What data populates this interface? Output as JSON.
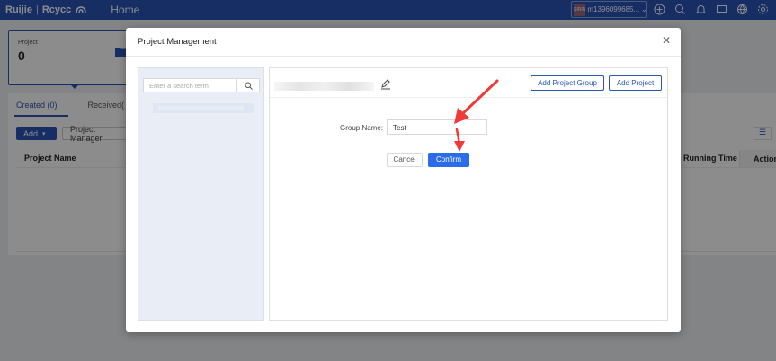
{
  "topbar": {
    "brand": "Ruijie",
    "brand_product": "Rcycc",
    "home_tab": "Home",
    "user_avatar_text": "SIRIN",
    "user_account": "m1396099685..."
  },
  "background": {
    "project_card_label": "Project",
    "project_card_count": "0",
    "tab_created": "Created (0)",
    "tab_received": "Received(",
    "add_button": "Add",
    "add_caret": "▾",
    "project_manager_button": "Project Manager",
    "col_project_name": "Project Name",
    "col_running_time": "Running Time",
    "col_action": "Action"
  },
  "modal": {
    "title": "Project Management",
    "close": "✕",
    "search_placeholder": "Enter a search term",
    "add_project_group": "Add Project Group",
    "add_project": "Add Project",
    "group_name_label": "Group Name:",
    "group_name_value": "Test",
    "cancel": "Cancel",
    "confirm": "Confirm"
  },
  "colors": {
    "accent": "#2b55b8",
    "confirm": "#2b6de8",
    "annotation_arrow": "#f03a3a"
  }
}
